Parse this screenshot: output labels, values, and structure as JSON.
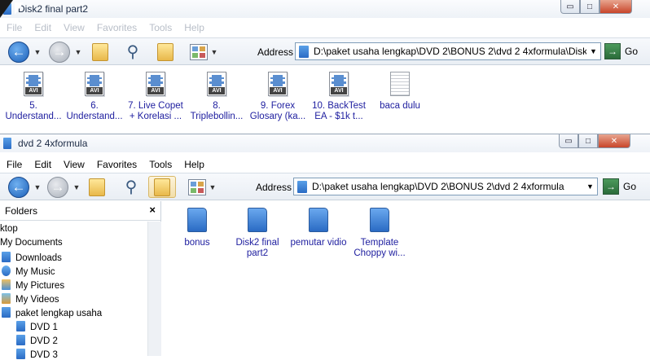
{
  "back_window": {
    "title": "Disk2 final part2",
    "menu": [
      "File",
      "Edit",
      "View",
      "Favorites",
      "Tools",
      "Help"
    ],
    "address_label": "Address",
    "address_value": "D:\\paket usaha lengkap\\DVD 2\\BONUS 2\\dvd 2 4xformula\\Disk2 final part2",
    "go_label": "Go",
    "files": [
      {
        "name_l1": "5.",
        "name_l2": "Understand...",
        "type": "AVI"
      },
      {
        "name_l1": "6.",
        "name_l2": "Understand...",
        "type": "AVI"
      },
      {
        "name_l1": "7. Live Copet",
        "name_l2": "+ Korelasi ...",
        "type": "AVI"
      },
      {
        "name_l1": "8.",
        "name_l2": "Triplebollin...",
        "type": "AVI"
      },
      {
        "name_l1": "9. Forex",
        "name_l2": "Glosary (ka...",
        "type": "AVI"
      },
      {
        "name_l1": "10. BackTest",
        "name_l2": "EA - $1k t...",
        "type": "AVI"
      },
      {
        "name_l1": "baca dulu",
        "name_l2": "",
        "type": "txt"
      }
    ]
  },
  "front_window": {
    "title": "dvd 2 4xformula",
    "menu": [
      "File",
      "Edit",
      "View",
      "Favorites",
      "Tools",
      "Help"
    ],
    "address_label": "Address",
    "address_value": "D:\\paket usaha lengkap\\DVD 2\\BONUS 2\\dvd 2 4xformula",
    "go_label": "Go",
    "folders_pane": {
      "title": "Folders",
      "close": "×",
      "items": [
        "ktop",
        "My Documents",
        "Downloads",
        "My Music",
        "My Pictures",
        "My Videos",
        "paket lengkap usaha",
        "DVD 1",
        "DVD 2",
        "DVD 3"
      ]
    },
    "folders": [
      {
        "name_l1": "bonus",
        "name_l2": ""
      },
      {
        "name_l1": "Disk2 final",
        "name_l2": "part2"
      },
      {
        "name_l1": "pemutar vidio",
        "name_l2": ""
      },
      {
        "name_l1": "Template",
        "name_l2": "Choppy wi..."
      }
    ]
  },
  "window_controls": {
    "minimize": "▭",
    "maximize": "□",
    "close": "✕"
  },
  "colors": {
    "link_blue": "#2020a0",
    "close_red": "#c8452a",
    "folder_blue": "#2a6bc4"
  },
  "icons": [
    "back-arrow-icon",
    "forward-arrow-icon",
    "up-folder-icon",
    "search-icon",
    "folders-icon",
    "views-icon",
    "go-arrow-icon"
  ]
}
